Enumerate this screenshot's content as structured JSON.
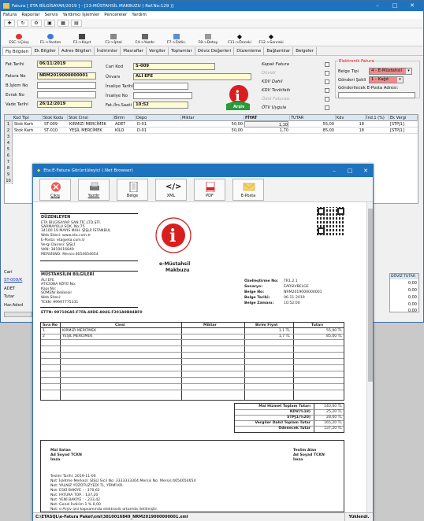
{
  "window": {
    "title": "Fatura [ ETA BİLGİSAYAR/2019 ] - [13-MÜSTAHSİL MAKBUZU ( Ref.No:129 )]"
  },
  "menu": [
    "Fatura",
    "Raporlar",
    "Servis",
    "Yardımcı İşlemler",
    "Pencereler",
    "Yardım"
  ],
  "toolbar": [
    {
      "label": "ESC->Çıkış",
      "icon": "exit-icon"
    },
    {
      "label": "F1->Yardım",
      "icon": "help-icon"
    },
    {
      "label": "F2->Kayıt",
      "icon": "save-icon"
    },
    {
      "label": "F3->İptal",
      "icon": "cancel-icon"
    },
    {
      "label": "F4->Yazdır",
      "icon": "print-icon"
    },
    {
      "label": "F7->Fatlis.",
      "icon": "list-icon"
    },
    {
      "label": "F8->Detay",
      "icon": "detail-icon"
    },
    {
      "label": "F11->Önceki",
      "icon": "prev-icon"
    },
    {
      "label": "F12->Sonraki",
      "icon": "next-icon"
    }
  ],
  "tabs": [
    "Fiş Bilgileri",
    "Ek Bilgiler",
    "Adres Bilgileri",
    "İndirimler",
    "Masraflar",
    "Vergiler",
    "Toplamlar",
    "Döviz Değerleri",
    "Düzenleme",
    "Bağlantılar",
    "Belgeler"
  ],
  "form": {
    "fat_tarihi_label": "Fat.Tarihi",
    "fat_tarihi": "06/11/2019",
    "fatura_no_label": "Fatura No",
    "fatura_no": "NRM2019000000001",
    "b_islem_no_label": "B.İşlem No",
    "b_islem_no": "",
    "evrak_no_label": "Evrak No",
    "evrak_no": "",
    "vade_tarihi_label": "Vade Tarihi",
    "vade_tarihi": "26/12/2019",
    "cari_kod_label": "Cari Kod",
    "cari_kod": "S-009",
    "unvani_label": "Ünvanı",
    "unvani": "ALİ EFE",
    "irsaliye_tarihi_label": "İrsaliye Tarihi",
    "irsaliye_tarihi": "",
    "irsaliye_no_label": "İrsaliye No",
    "irsaliye_no": "",
    "fat_irs_saati_label": "Fat./İrs.Saati",
    "fat_irs_saati": "10:52",
    "checks": [
      "Kapalı Fatura",
      "Dövizli",
      "KDV Dahil",
      "KDV Tevkifatlı",
      "Ödül Faturası",
      "ÖTV Uygula"
    ],
    "efatura_title": "Elektronik Fatura",
    "belge_tipi_label": "Belge Tipi",
    "belge_tipi": "4 - E-Müstahsil",
    "gonderi_sekli_label": "Gönderi Şekli",
    "gonderi_sekli": "1 - Kağıt",
    "eposta_label": "Gönderilecek E-Posta Adresi:",
    "earsiv": "Arşiv"
  },
  "grid": {
    "headers": [
      "Kod Tipi",
      "Stok Kodu",
      "Stok Cinsi",
      "Birim",
      "Depo",
      "Miktar",
      "FİYAT",
      "TUTAR",
      "Kdv",
      "İnd.1 (%)",
      "Ek Vergi"
    ],
    "rows": [
      [
        "1",
        "Stok Kartı",
        "ST-009",
        "KIRMIZI MERCİMEK",
        "ADET",
        "D-01",
        "50,00",
        "1,10",
        "55,00",
        "18",
        "[STPJ1]"
      ],
      [
        "2",
        "Stok Kartı",
        "ST-010",
        "YEŞİL MERCİMEK",
        "KİLO",
        "D-01",
        "50,00",
        "1,70",
        "85,00",
        "18",
        "[STPJ1]"
      ]
    ],
    "row_numbers": [
      "3",
      "4",
      "5",
      "6",
      "7",
      "8",
      "9",
      "10"
    ]
  },
  "bottom": {
    "cari": "Cari",
    "cari_code": "ST-009/K",
    "adet": "ADET",
    "tutar": "Tutar",
    "har_aded": "Har.Aded",
    "doviz_tutar": "DÖVİZ TUTAR",
    "doviz_values": [
      "0,00",
      "0,00",
      "0,00",
      "0,00",
      "0,00"
    ]
  },
  "viewer": {
    "title": "Eta:E-Fatura Görüntüleyici (.Net Browser)",
    "buttons": [
      {
        "label": "Çıkış",
        "icon": "close-icon"
      },
      {
        "label": "Yazdır",
        "icon": "print-icon"
      },
      {
        "label": "Belge",
        "icon": "document-icon"
      },
      {
        "label": "XML",
        "icon": "code-icon"
      },
      {
        "label": "PDF",
        "icon": "pdf-icon"
      },
      {
        "label": "E-Posta",
        "icon": "mail-icon"
      }
    ],
    "status_path": "C:\\ETASQL\\e-Fatura Paket\\xml\\3810016849_NRM2019000000001.xml",
    "status_right": "Yüklendi."
  },
  "doc": {
    "seller_title": "DÜZENLEYEN",
    "seller_lines": [
      "ETA BİLGİSAYAR SAN.TİC.LTD.ŞTİ.",
      "SARMAYOLU SOK. No:75",
      "34100 19 MAYIS MAH. ŞİŞLİ/ İSTANBUL",
      "Web Sitesi: www.eta.com.tr",
      "E-Posta: eta@eta.com.tr",
      "Vergi Dairesi: ŞİŞLİ",
      "VKN: 3810016849",
      "MERSİSNO: Mersis:4654654654"
    ],
    "buyer_title": "MÜSTAHSİLIN BİLGİLERİ",
    "buyer_lines": [
      "ALİ EFE",
      "ATICIOBA KÖYÜ  No:",
      "Kapı No:",
      "  SOMEN/ Belikesir",
      "Web Sitesi:",
      "TCKN: 99997775331"
    ],
    "doc_title_1": "e-Müstahsil",
    "doc_title_2": "Makbuzu",
    "ettn": "ETTN: 997106A5-F7FA-48DE-A946-F201A9B84BF0",
    "meta": [
      [
        "Özelleştirme No:",
        "TR1.2.1"
      ],
      [
        "Senaryo:",
        "EARSIVBELGE"
      ],
      [
        "Belge No:",
        "NRM2019000000001"
      ],
      [
        "Belge Tarihi:",
        "06-11-2019"
      ],
      [
        "Belge Zamanı:",
        "10:52:00"
      ]
    ],
    "table_headers": [
      "Sıra No",
      "Cinsi",
      "Miktar",
      "Birim Fiyat",
      "Tutarı"
    ],
    "table_rows": [
      [
        "1",
        "KIRMIZI MERCİMEK",
        "",
        "1,1 TL",
        "55,00 TL"
      ],
      [
        "2",
        "YEŞİL MERCİMEK",
        "",
        "1,7 TL",
        "85,00 TL"
      ]
    ],
    "totals": [
      [
        "Mal Hizmet Toplam Tutarı",
        "140,00 TL"
      ],
      [
        "KDV(%18)",
        "25,20 TL"
      ],
      [
        "STPJ1(%20)",
        "28,00 TL"
      ],
      [
        "Vergiler Dahil Toplam Tutar",
        "165,20 TL"
      ],
      [
        "Ödenecek Tutar",
        "137,20 TL"
      ]
    ],
    "sig_left": [
      "Mal Satan",
      "Ad Soyad TCKN",
      "İmza"
    ],
    "sig_right": [
      "Teslim Alan",
      "Ad Soyad TCKN",
      "İmza"
    ],
    "notes": [
      "Teslim Tarihi: 2019-11-06",
      "Not: İşletme Merkezi: ŞİŞLİ Sicil No: 3333333304 Mersis No: Mersis:4654654654",
      "Not: YALNIZ YÜZOTUZYEDİ TL, YİRMİ KR.",
      "Not: ESKİ BAKİYE : - 370,62",
      "Not: FATURA TOP. : 137,20",
      "Not: YENİ BAKİYE : - 233,42",
      "Not: Genel İndirim 1 % 0,00",
      "Not: e-Arşiv izni kapsamında elektronik ortamda iletilmiştir."
    ],
    "seal_text": "Gelir İdaresi Başkanlığı"
  }
}
